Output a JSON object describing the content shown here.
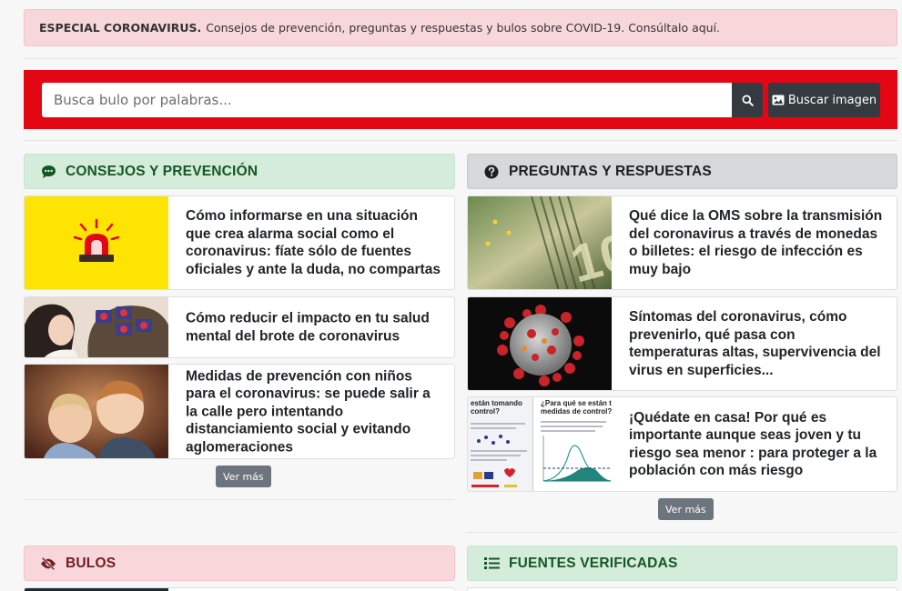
{
  "alert": {
    "bold": "ESPECIAL CORONAVIRUS.",
    "text": "Consejos de prevención, preguntas y respuestas y bulos sobre COVID-19. Consúltalo aquí."
  },
  "search": {
    "placeholder": "Busca bulo por palabras...",
    "image_button": "Buscar imagen"
  },
  "sections": {
    "consejos": {
      "title": "CONSEJOS Y PREVENCIÓN",
      "items": [
        "Cómo informarse en una situación que crea alarma social como el coronavirus: fíate sólo de fuentes oficiales y ante la duda, no compartas",
        "Cómo reducir el impacto en tu salud mental del brote de coronavirus",
        "Medidas de prevención con niños para el coronavirus: se puede salir a la calle pero intentando distanciamiento social y evitando aglomeraciones"
      ],
      "more": "Ver más"
    },
    "preguntas": {
      "title": "PREGUNTAS Y RESPUESTAS",
      "items": [
        "Qué dice la OMS sobre la transmisión del coronavirus a través de monedas o billetes: el riesgo de infección es muy bajo",
        "Síntomas del coronavirus, cómo prevenirlo, qué pasa con temperaturas altas, supervivencia del virus en superficies...",
        "¡Quédate en casa! Por qué es importante aunque seas joven y tu riesgo sea menor : para proteger a la población con más riesgo"
      ],
      "thumb3_text": {
        "left_a": "están tomando",
        "left_b": "control?",
        "right_a": "¿Para qué se están toma",
        "right_b": "medidas de control?"
      },
      "more": "Ver más"
    },
    "bulos": {
      "title": "BULOS"
    },
    "fuentes": {
      "title": "FUENTES VERIFICADAS"
    }
  },
  "colors": {
    "brand_red": "#e30613",
    "green_header": "#d4edda",
    "grey_header": "#d6d8db",
    "red_header": "#f8d7da"
  },
  "icons": [
    "siren-icon",
    "comment-dots-icon",
    "question-circle-icon",
    "eye-slash-icon",
    "list-icon",
    "search-icon",
    "image-icon"
  ]
}
